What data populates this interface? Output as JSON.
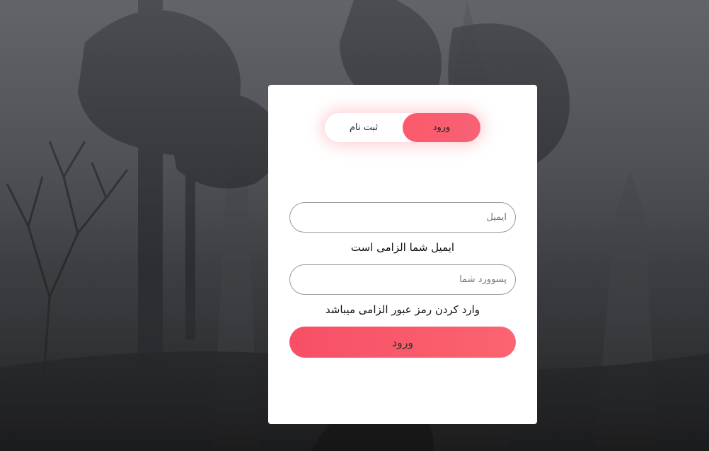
{
  "auth_toggle": {
    "login_label": "ورود",
    "signup_label": "ثبت نام",
    "active": "login"
  },
  "form": {
    "email_placeholder": "ایمیل",
    "email_value": "",
    "email_error": "ایمیل شما الزامی است",
    "password_placeholder": "پسوورد شما",
    "password_value": "",
    "password_error": "وارد کردن رمز عبور الزامی میباشد",
    "submit_label": "ورود"
  },
  "colors": {
    "accent": "#f95a6c",
    "card_background": "#ffffff"
  }
}
